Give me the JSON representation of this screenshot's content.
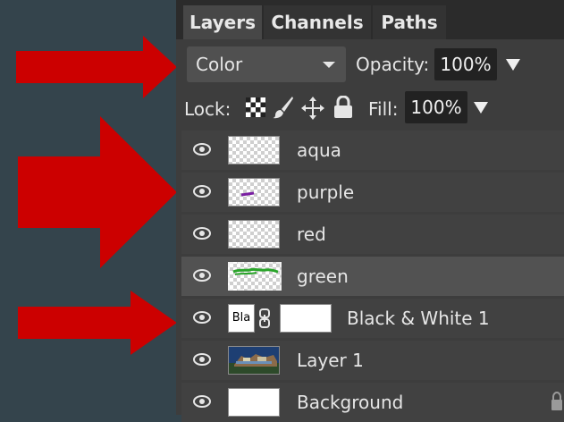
{
  "tabs": [
    {
      "label": "Layers",
      "active": true
    },
    {
      "label": "Channels",
      "active": false
    },
    {
      "label": "Paths",
      "active": false
    }
  ],
  "blend_mode": {
    "selected": "Color"
  },
  "opacity": {
    "label": "Opacity:",
    "value": "100%"
  },
  "lock": {
    "label": "Lock:",
    "icons": [
      "transparency-lock-icon",
      "brush-lock-icon",
      "move-lock-icon",
      "padlock-icon"
    ]
  },
  "fill": {
    "label": "Fill:",
    "value": "100%"
  },
  "layers": [
    {
      "name": "aqua",
      "visible": true,
      "thumbnail": "transparent"
    },
    {
      "name": "purple",
      "visible": true,
      "thumbnail": "transparent-with-purple-stroke"
    },
    {
      "name": "red",
      "visible": true,
      "thumbnail": "transparent"
    },
    {
      "name": "green",
      "visible": true,
      "selected": true,
      "thumbnail": "transparent-with-green-stroke"
    },
    {
      "name": "Black & White 1",
      "visible": true,
      "thumbnail_text": "Bla",
      "type": "adjustment"
    },
    {
      "name": "Layer 1",
      "visible": true,
      "thumbnail": "photo"
    },
    {
      "name": "Background",
      "visible": true,
      "thumbnail": "white",
      "locked": true
    }
  ],
  "colors": {
    "arrow": "#cc0000",
    "page_bg": "#34444c",
    "panel_bg": "#3d3d3d",
    "selected_row": "#525252"
  }
}
